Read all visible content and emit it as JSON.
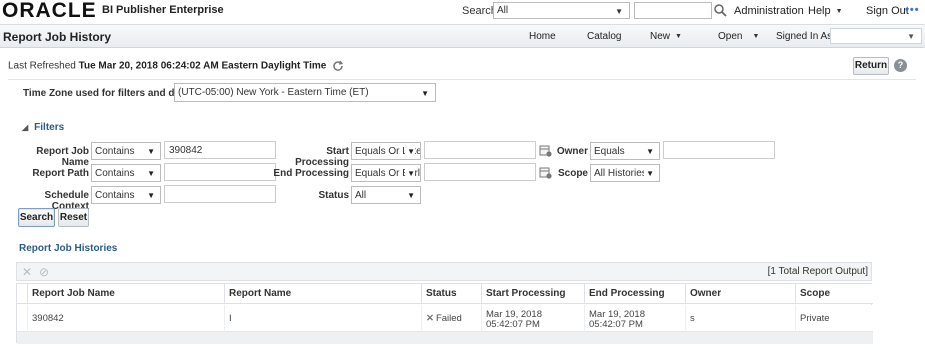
{
  "topbar": {
    "logo": "ORACLE",
    "product": "BI Publisher Enterprise",
    "search_label": "Search",
    "search_scope": "All",
    "administration": "Administration",
    "help": "Help",
    "sign_out": "Sign Out",
    "more": "•••"
  },
  "header": {
    "title": "Report Job History",
    "home": "Home",
    "catalog": "Catalog",
    "new": "New",
    "open": "Open",
    "signed_in_as": "Signed In As"
  },
  "status": {
    "last_refreshed_label": "Last Refreshed",
    "last_refreshed_value": "Tue Mar 20, 2018 06:24:02 AM Eastern Daylight Time",
    "return_label": "Return",
    "help_glyph": "?"
  },
  "timezone": {
    "label": "Time Zone used for filters and display",
    "value": "(UTC-05:00) New York - Eastern Time (ET)"
  },
  "filters": {
    "title": "Filters",
    "report_job_name": {
      "label": "Report Job Name",
      "operator": "Contains",
      "value": "390842"
    },
    "report_path": {
      "label": "Report Path",
      "operator": "Contains",
      "value": ""
    },
    "schedule_context": {
      "label": "Schedule Context",
      "operator": "Contains",
      "value": ""
    },
    "start_processing": {
      "label": "Start Processing",
      "operator": "Equals Or Later",
      "value": ""
    },
    "end_processing": {
      "label": "End Processing",
      "operator": "Equals Or Earlier",
      "value": ""
    },
    "status": {
      "label": "Status",
      "value": "All"
    },
    "owner": {
      "label": "Owner",
      "operator": "Equals",
      "value": ""
    },
    "scope": {
      "label": "Scope",
      "value": "All Histories"
    },
    "search_button": "Search",
    "reset_button": "Reset"
  },
  "histories": {
    "title": "Report Job Histories",
    "total_output": "[1 Total Report Output]",
    "columns": [
      "Report Job Name",
      "Report Name",
      "Status",
      "Start Processing",
      "End Processing",
      "Owner",
      "Scope"
    ],
    "rows": [
      {
        "job_name": "390842",
        "report_name": "I",
        "status": "Failed",
        "start": "Mar 19, 2018 05:42:07 PM",
        "end": "Mar 19, 2018 05:42:07 PM",
        "owner": "s",
        "scope": "Private"
      }
    ]
  }
}
